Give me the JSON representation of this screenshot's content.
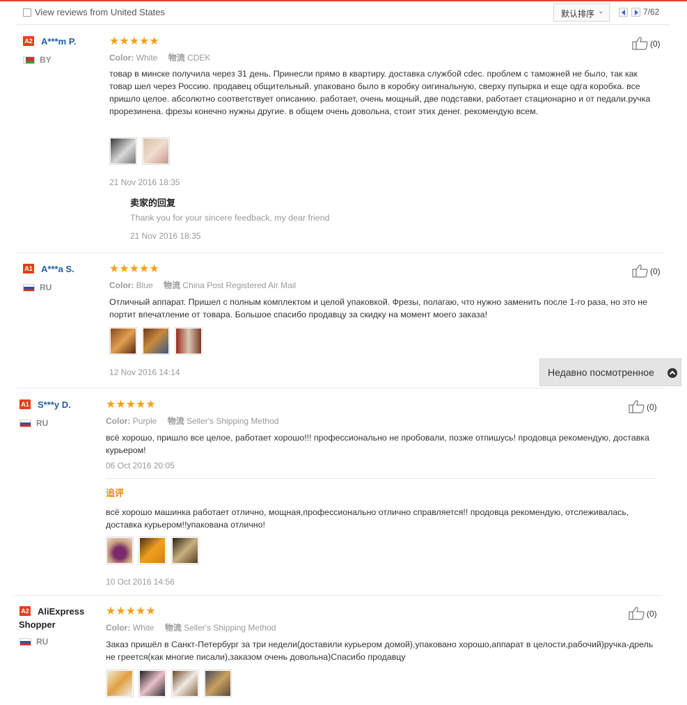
{
  "filter": {
    "checkbox_label": "View reviews from United States",
    "sort_label": "默认排序",
    "page_indicator": "7/62"
  },
  "recently_viewed": {
    "label": "Недавно посмотренное"
  },
  "colors": {
    "accent": "#e8402a",
    "star": "#f6a01a",
    "username": "#1f5fa8",
    "append": "#f28c00"
  },
  "reviews": [
    {
      "level": "A2",
      "user": "A***m P.",
      "country": "BY",
      "rating": "★★★★★",
      "color_key": "Color:",
      "color_val": "White",
      "ship_key": "物流",
      "ship_val": "CDEK",
      "text": "товар в минске получила через 31 день. Принесли прямо в квартиру. доставка службой cdec. проблем с таможней не было, так как товар шел через Россию. продавец общительный. упаковано было в коробку оигинальную, сверху пупырка и еще одга коробка. все пришло целое. абсолютно соответствует описанию. работает, очень мощный, две подставки, работает стационарно и от педали.ручка прорезинена. фрезы конечно нужны другие. в общем очень довольна, стоит этих денег. рекомендую всем.",
      "date": "21 Nov 2016 18:35",
      "likes": "(0)",
      "seller_reply": {
        "title": "卖家的回复",
        "text": "Thank you for your sincere feedback, my dear friend",
        "date": "21 Nov 2016 18:35"
      }
    },
    {
      "level": "A1",
      "user": "A***a S.",
      "country": "RU",
      "rating": "★★★★★",
      "color_key": "Color:",
      "color_val": "Blue",
      "ship_key": "物流",
      "ship_val": "China Post Registered Air Mail",
      "text": "Отличный аппарат. Пришел с полным комплектом и целой упаковкой. Фрезы, полагаю, что нужно заменить после 1-го раза, но это не портит впечатление от товара. Большое спасибо продавцу за скидку на момент моего заказа!",
      "date": "12 Nov 2016 14:14",
      "likes": "(0)"
    },
    {
      "level": "A1",
      "user": "S***y D.",
      "country": "RU",
      "rating": "★★★★★",
      "color_key": "Color:",
      "color_val": "Purple",
      "ship_key": "物流",
      "ship_val": "Seller's Shipping Method",
      "text": "всё хорошо, пришло все целое, работает хорошо!!! профессионально не пробовали, позже отпишусь! продовца рекомендую, доставка курьером!",
      "date": "06 Oct 2016 20:05",
      "likes": "(0)",
      "append": {
        "title": "追评",
        "text": "всё хорошо машинка работает отлично, мощная,профессионально отлично справляется!! продовца рекомендую, отслеживалась, доставка курьером!!упакована отлично!",
        "date": "10 Oct 2016 14:56"
      }
    },
    {
      "level": "A2",
      "user": "AliExpress Shopper",
      "country": "RU",
      "rating": "★★★★★",
      "color_key": "Color:",
      "color_val": "White",
      "ship_key": "物流",
      "ship_val": "Seller's Shipping Method",
      "text": "Заказ пришёл в Санкт-Петербург за три недели(доставили курьером домой),упаковано хорошо,аппарат в целости,рабочий)ручка-дрель не греется(как многие писали),заказом очень довольна)Спасибо продавцу",
      "likes": "(0)"
    }
  ]
}
